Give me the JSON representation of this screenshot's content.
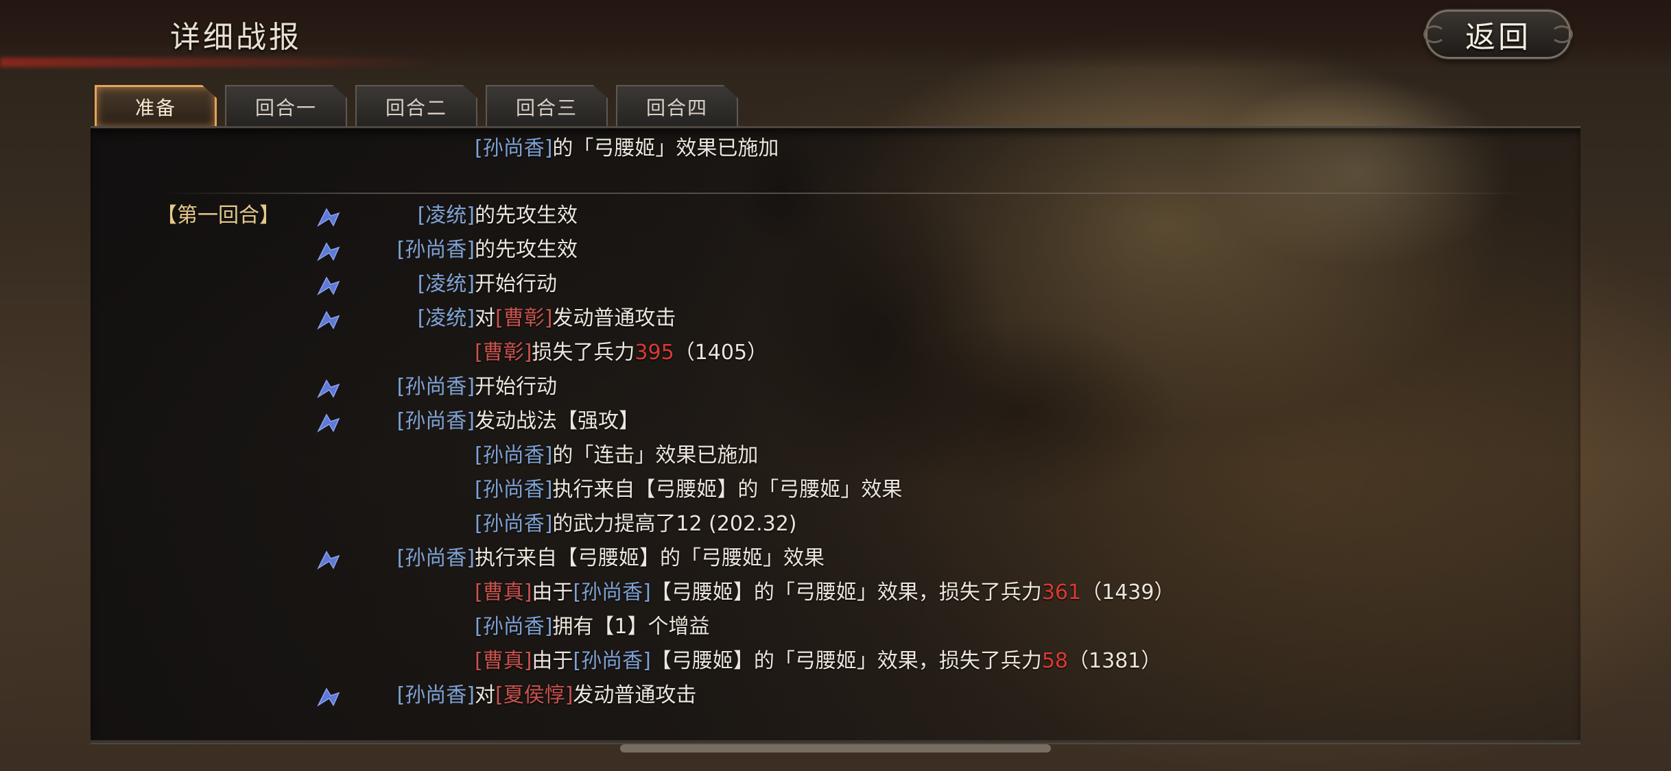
{
  "header": {
    "title": "详细战报",
    "back_label": "返回"
  },
  "tabs": [
    {
      "label": "准备",
      "active": true
    },
    {
      "label": "回合一",
      "active": false
    },
    {
      "label": "回合二",
      "active": false
    },
    {
      "label": "回合三",
      "active": false
    },
    {
      "label": "回合四",
      "active": false
    }
  ],
  "colors": {
    "ally_name": "#7ea2d4",
    "enemy_name": "#c8524e",
    "damage_number": "#d93a34",
    "round_label": "#e6c98a",
    "active_tab_border": "#e5a35a"
  },
  "report": {
    "prep_line": {
      "name": "[孙尚香]",
      "text": "的「弓腰姬」效果已施加"
    },
    "round_label": "【第一回合】",
    "entries": [
      {
        "actor": "[凌统]",
        "text": "的先攻生效"
      },
      {
        "actor": "[孙尚香]",
        "text": "的先攻生效"
      },
      {
        "actor": "[凌统]",
        "text": "开始行动"
      },
      {
        "actor": "[凌统]",
        "t1": "对",
        "target": "[曹彰]",
        "t2": "发动普通攻击"
      },
      {
        "target": "[曹彰]",
        "t1": "损失了兵力",
        "num": "395",
        "t2": "（1405）"
      },
      {
        "actor": "[孙尚香]",
        "text": "开始行动"
      },
      {
        "actor": "[孙尚香]",
        "text": "发动战法【强攻】"
      },
      {
        "name": "[孙尚香]",
        "text": "的「连击」效果已施加"
      },
      {
        "name": "[孙尚香]",
        "text": "执行来自【弓腰姬】的「弓腰姬」效果"
      },
      {
        "name": "[孙尚香]",
        "text": "的武力提高了12 (202.32)"
      },
      {
        "actor": "[孙尚香]",
        "text": "执行来自【弓腰姬】的「弓腰姬」效果"
      },
      {
        "target": "[曹真]",
        "t1": "由于",
        "name": "[孙尚香]",
        "t2": "【弓腰姬】的「弓腰姬」效果，损失了兵力",
        "num": "361",
        "t3": "（1439）"
      },
      {
        "name": "[孙尚香]",
        "text": "拥有【1】个增益"
      },
      {
        "target": "[曹真]",
        "t1": "由于",
        "name": "[孙尚香]",
        "t2": "【弓腰姬】的「弓腰姬」效果，损失了兵力",
        "num": "58",
        "t3": "（1381）"
      },
      {
        "actor": "[孙尚香]",
        "t1": "对",
        "target": "[夏侯惇]",
        "t2": "发动普通攻击"
      }
    ],
    "icons": {
      "action_marker": "blue-horse-arrow-icon"
    }
  }
}
